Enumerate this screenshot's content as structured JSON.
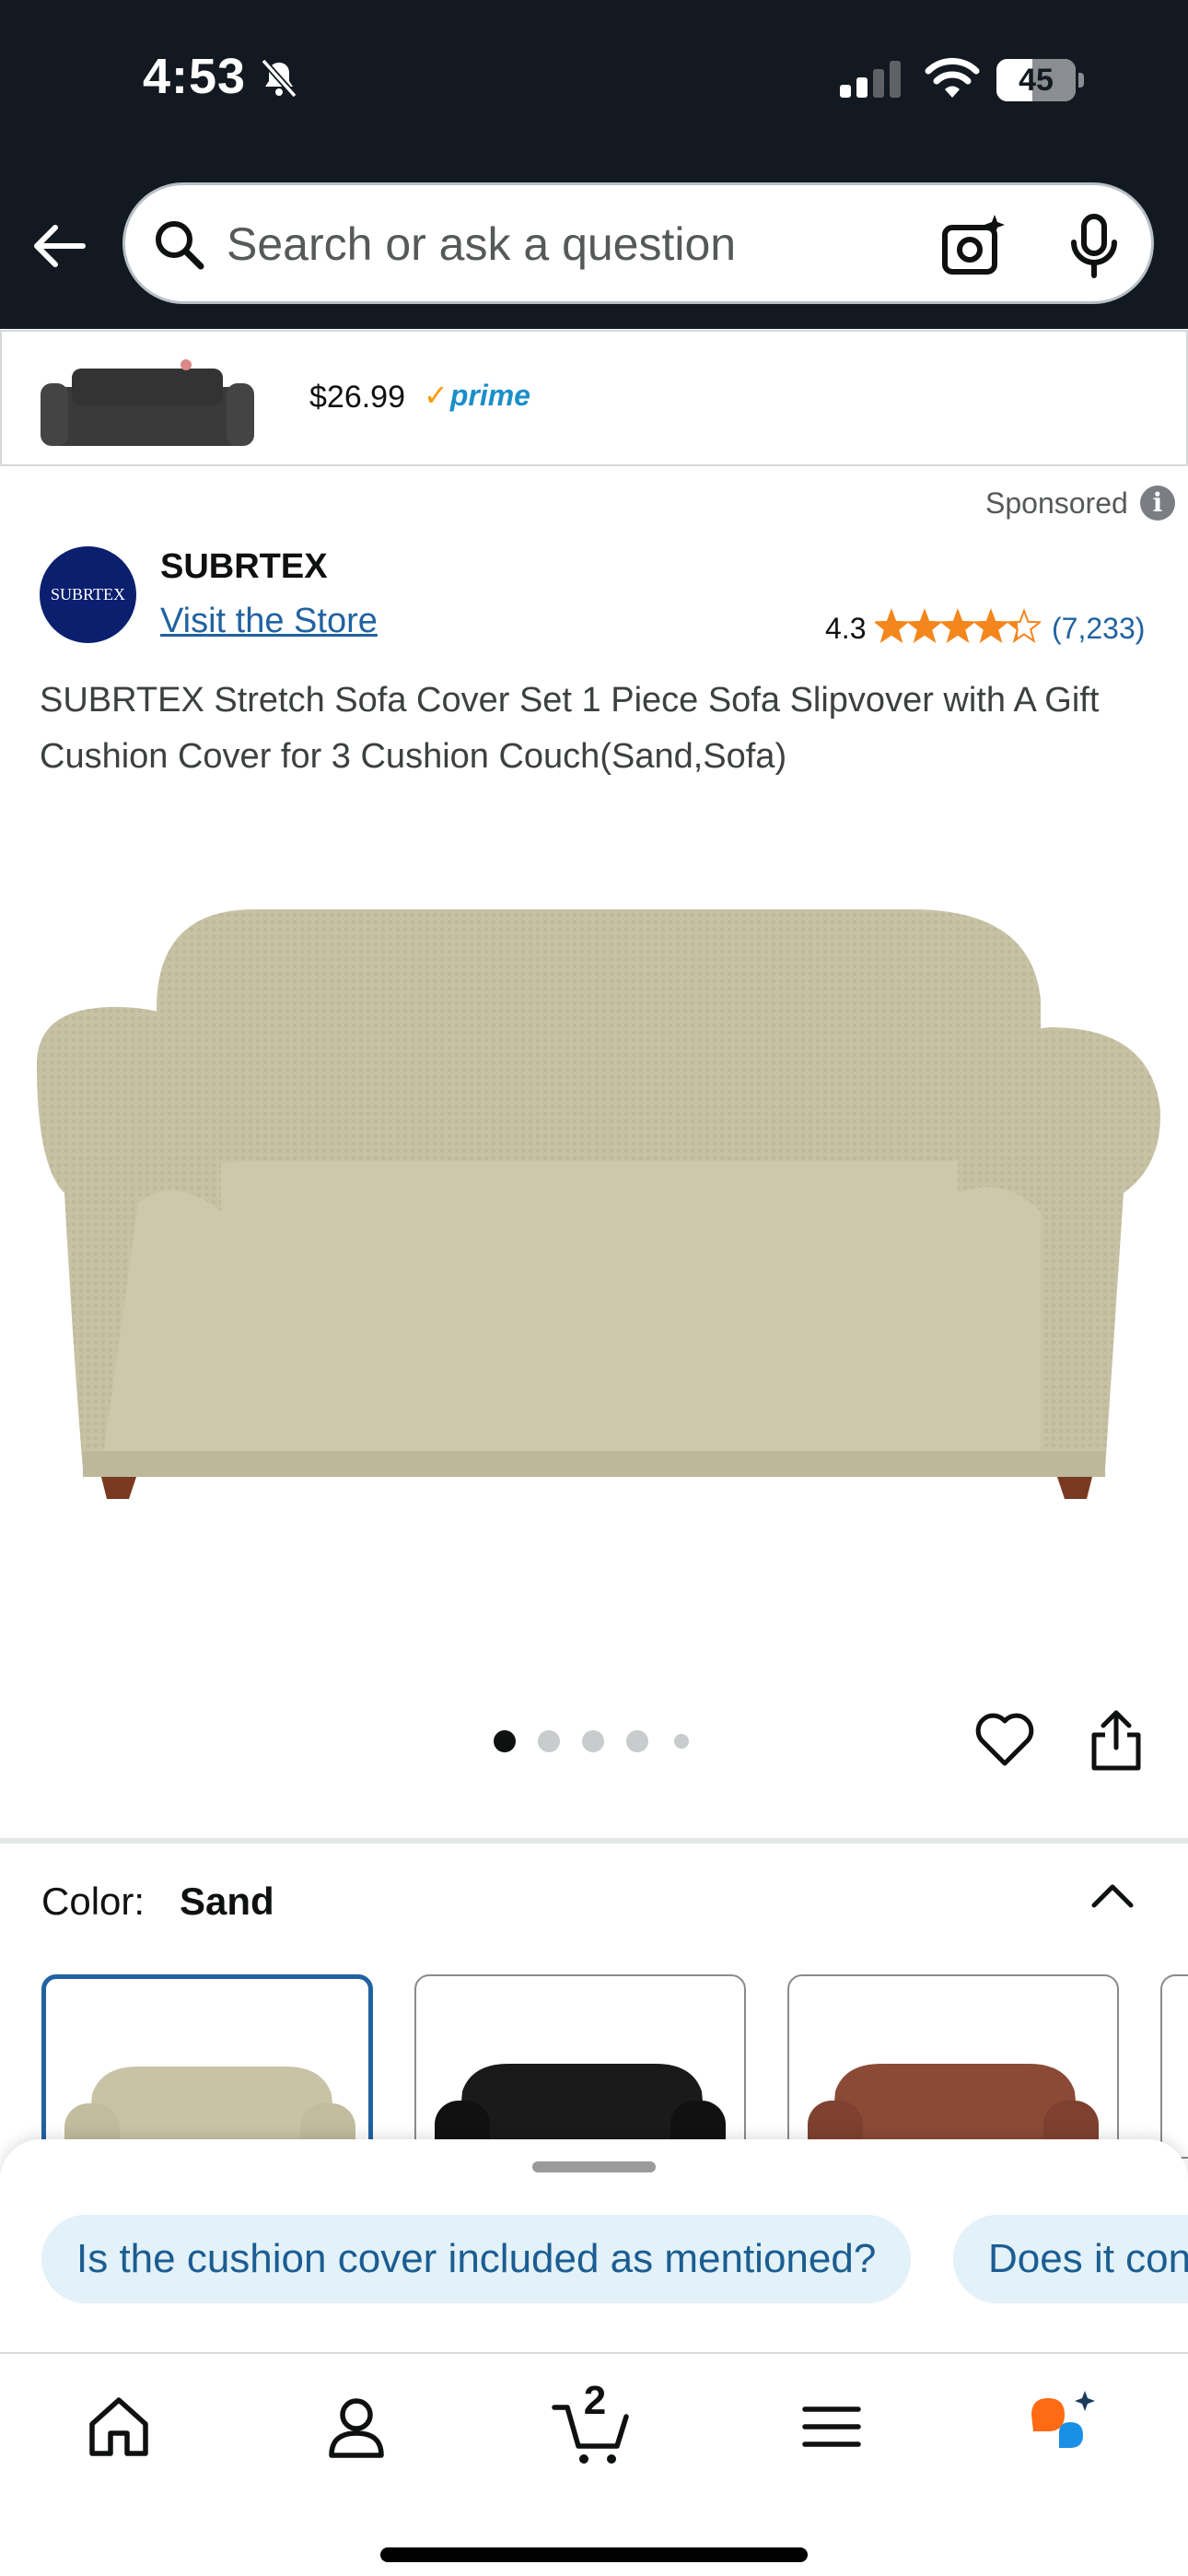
{
  "status_bar": {
    "time": "4:53",
    "battery_level": "45",
    "battery_fraction": 0.45
  },
  "header": {
    "search_placeholder": "Search or ask a question"
  },
  "sticky_strip": {
    "price": "$26.99",
    "prime_label": "prime"
  },
  "product": {
    "sponsored_label": "Sponsored",
    "brand_logo_text": "SUBRTEX",
    "brand_name": "SUBRTEX",
    "store_link": "Visit the Store",
    "rating": "4.3",
    "rating_value": 4.3,
    "rating_count": "(7,233)",
    "title": "SUBRTEX Stretch Sofa Cover Set 1 Piece Sofa Slipvover with A Gift Cushion Cover for 3 Cushion Couch(Sand,Sofa)",
    "image_count": 5,
    "active_image": 0
  },
  "color_selector": {
    "label": "Color:",
    "selected": "Sand",
    "swatches": [
      {
        "name": "Sand",
        "color": "#c9c3a6"
      },
      {
        "name": "Black",
        "color": "#1a1a1a"
      },
      {
        "name": "Brown",
        "color": "#8a4a36"
      }
    ]
  },
  "suggestions": {
    "chips": [
      "Is the cushion cover included as mentioned?",
      "Does it con"
    ]
  },
  "tabbar": {
    "cart_count": "2"
  },
  "colors": {
    "header_bg": "#131921",
    "link": "#2162a1",
    "star": "#f3861c",
    "prime": "#1a8fc9"
  }
}
